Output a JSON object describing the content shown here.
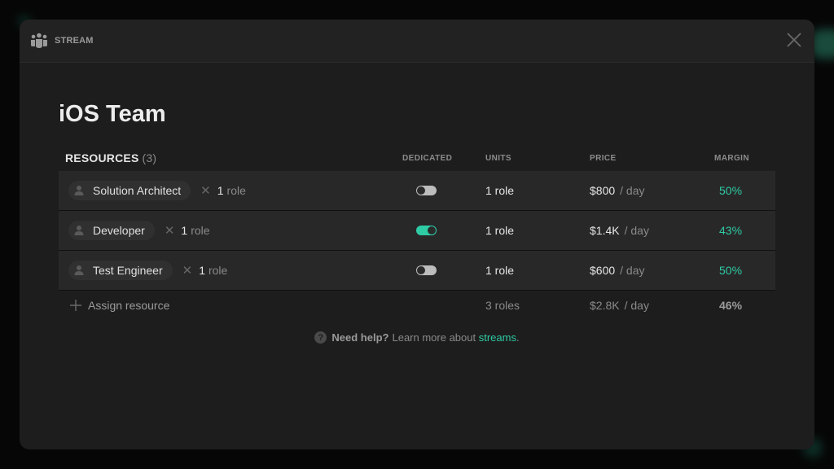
{
  "header": {
    "icon": "team-icon",
    "label": "STREAM",
    "close_icon": "close-icon"
  },
  "title": "iOS Team",
  "table": {
    "resources_label": "RESOURCES",
    "resources_count": "(3)",
    "columns": {
      "dedicated": "DEDICATED",
      "units": "UNITS",
      "price": "PRICE",
      "margin": "MARGIN"
    },
    "rows": [
      {
        "role": "Solution Architect",
        "qty": "1",
        "qty_unit": "role",
        "dedicated": false,
        "units": "1 role",
        "price": "$800",
        "per": "/ day",
        "margin": "50%"
      },
      {
        "role": "Developer",
        "qty": "1",
        "qty_unit": "role",
        "dedicated": true,
        "units": "1 role",
        "price": "$1.4K",
        "per": "/ day",
        "margin": "43%"
      },
      {
        "role": "Test Engineer",
        "qty": "1",
        "qty_unit": "role",
        "dedicated": false,
        "units": "1 role",
        "price": "$600",
        "per": "/ day",
        "margin": "50%"
      }
    ],
    "footer": {
      "assign_label": "Assign resource",
      "total_units": "3 roles",
      "total_price": "$2.8K",
      "total_per": "/ day",
      "total_margin": "46%"
    }
  },
  "help": {
    "bold": "Need help?",
    "text": "Learn more about",
    "link": "streams",
    "suffix": "."
  },
  "colors": {
    "accent": "#2ecba4",
    "modal_bg": "#1d1d1d",
    "row_bg": "#282828"
  }
}
